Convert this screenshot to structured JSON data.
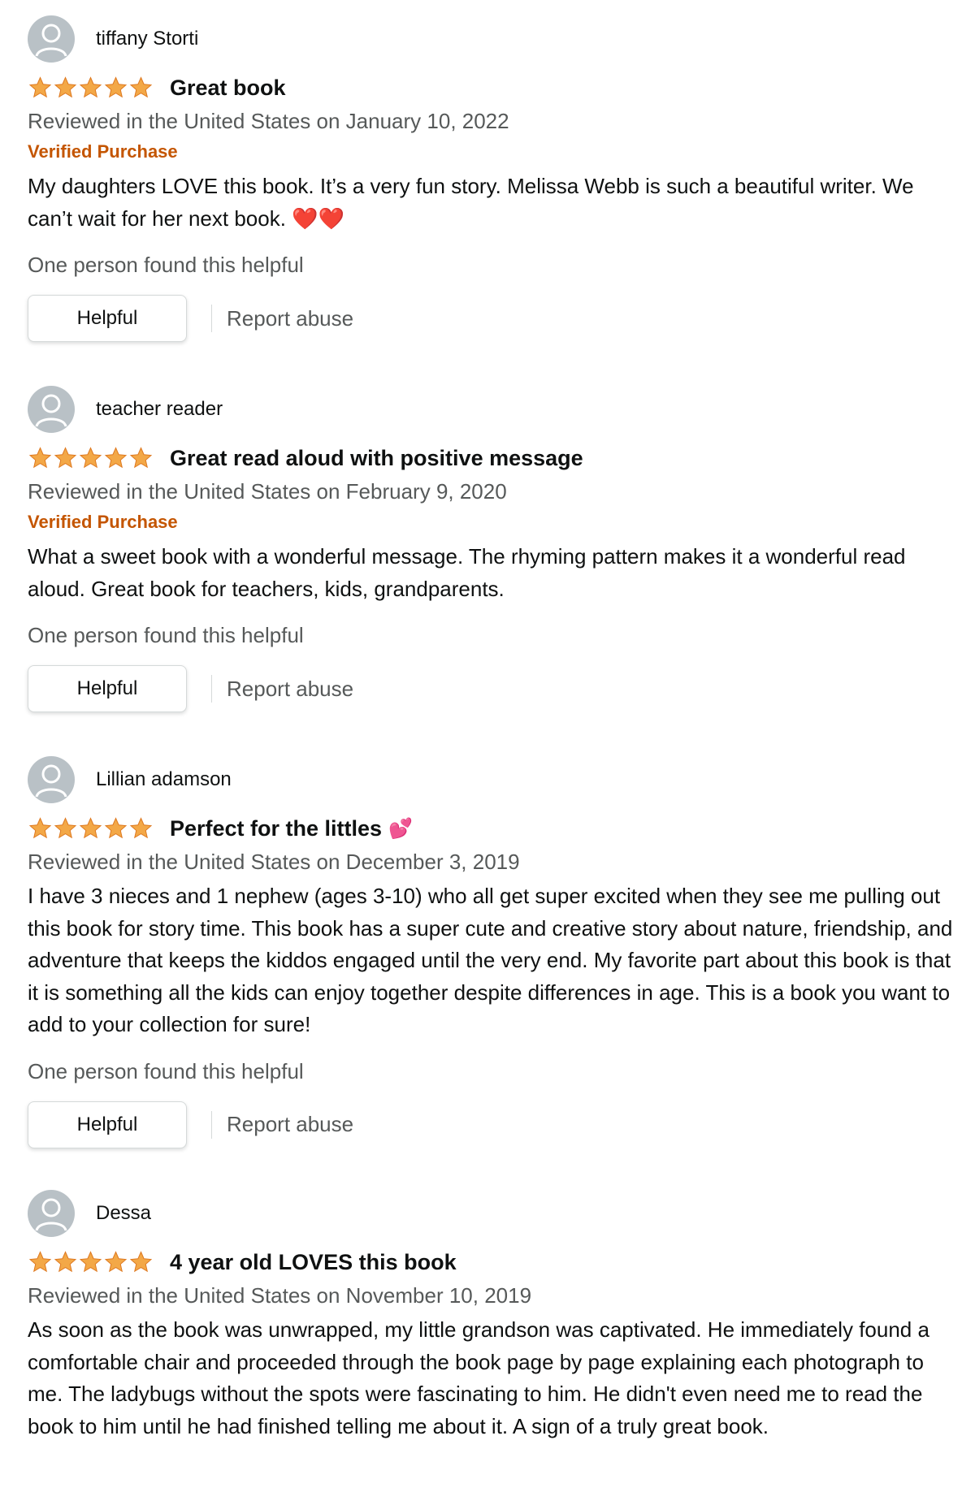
{
  "colors": {
    "star": "#f3a847",
    "verified": "#c45500",
    "secondary_text": "#565959",
    "avatar_bg": "#b9c1c6"
  },
  "icons": {
    "avatar": "default-profile-avatar-icon",
    "star": "star-filled-icon",
    "heart": "red-heart-emoji",
    "pink_hearts": "two-pink-hearts-emoji"
  },
  "reviews": [
    {
      "name": "tiffany Storti",
      "stars": 5,
      "title": "Great book",
      "date": "Reviewed in the United States on January 10, 2022",
      "verified": "Verified Purchase",
      "body": "My daughters LOVE this book. It’s a very fun story. Melissa Webb is such a beautiful writer. We can’t wait for her next book. ❤️❤️",
      "helpful_count": "One person found this helpful",
      "helpful_button": "Helpful",
      "report": "Report abuse"
    },
    {
      "name": "teacher reader",
      "stars": 5,
      "title": "Great read aloud with positive message",
      "date": "Reviewed in the United States on February 9, 2020",
      "verified": "Verified Purchase",
      "body": "What a sweet book with a wonderful message. The rhyming pattern makes it a wonderful read aloud. Great book for teachers, kids, grandparents.",
      "helpful_count": "One person found this helpful",
      "helpful_button": "Helpful",
      "report": "Report abuse"
    },
    {
      "name": "Lillian adamson",
      "stars": 5,
      "title": "Perfect for the littles",
      "title_emoji": "💕",
      "date": "Reviewed in the United States on December 3, 2019",
      "body": "I have 3 nieces and 1 nephew (ages 3-10) who all get super excited when they see me pulling out this book for story time. This book has a super cute and creative story about nature, friendship, and adventure that keeps the kiddos engaged until the very end. My favorite part about this book is that it is something all the kids can enjoy together despite differences in age. This is a book you want to add to your collection for sure!",
      "helpful_count": "One person found this helpful",
      "helpful_button": "Helpful",
      "report": "Report abuse"
    },
    {
      "name": "Dessa",
      "stars": 5,
      "title": "4 year old LOVES this book",
      "date": "Reviewed in the United States on November 10, 2019",
      "body": "As soon as the book was unwrapped, my little grandson was captivated. He immediately found a comfortable chair and proceeded through the book page by page explaining each photograph to me. The ladybugs without the spots were fascinating to him. He didn't even need me to read the book to him until he had finished telling me about it. A sign of a truly great book."
    }
  ]
}
